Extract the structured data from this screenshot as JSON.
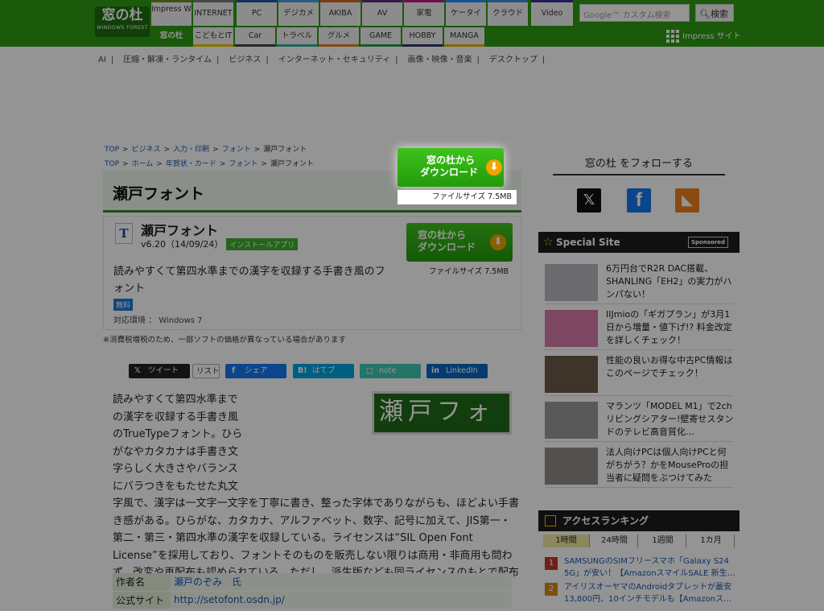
{
  "header": {
    "logo": {
      "main": "窓の杜",
      "sub": "WINDOWS FOREST"
    },
    "nav_row1": [
      {
        "label": "Impress Watch",
        "color": "#6b8e23"
      },
      {
        "label": "INTERNET",
        "color": "#7a7a7a"
      },
      {
        "label": "PC",
        "color": "#2156a5"
      },
      {
        "label": "デジカメ",
        "color": "#4aa0d8"
      },
      {
        "label": "AKIBA",
        "color": "#d2691e"
      },
      {
        "label": "AV",
        "color": "#5b2c83"
      },
      {
        "label": "家電",
        "color": "#c71585"
      },
      {
        "label": "ケータイ",
        "color": "#1e90ff"
      },
      {
        "label": "クラウド",
        "color": "#3a8fd8"
      },
      {
        "label": "Video",
        "color": "#333399"
      }
    ],
    "nav_row2": [
      {
        "label": "窓の杜",
        "color": "#2f9a14"
      },
      {
        "label": "こどもとIT",
        "color": "#f0c000"
      },
      {
        "label": "Car",
        "color": "#444444"
      },
      {
        "label": "トラベル",
        "color": "#2ab0a0"
      },
      {
        "label": "グルメ",
        "color": "#e08020"
      },
      {
        "label": "GAME",
        "color": "#2a9a4a"
      },
      {
        "label": "HOBBY",
        "color": "#333366"
      },
      {
        "label": "MANGA",
        "color": "#e4b000"
      }
    ],
    "search_placeholder": "Google™ カスタム検索",
    "search_button": "検索",
    "impress_link": "Impress サイト"
  },
  "subnav": [
    "AI",
    "|",
    "圧縮・解凍・ランタイム",
    "|",
    "ビジネス",
    "|",
    "インターネット・セキュリティ",
    "|",
    "画像・映像・音楽",
    "|",
    "デスクトップ",
    "|"
  ],
  "breadcrumbs": {
    "line1": [
      "TOP",
      ">",
      "ビジネス",
      ">",
      "入力・印刷",
      ">",
      "フォント",
      ">",
      "瀬戸フォント"
    ],
    "line2": [
      "TOP",
      ">",
      "ホーム",
      ">",
      "年賀状・カード",
      ">",
      "フォント",
      ">",
      "瀬戸フォント"
    ]
  },
  "page_title": "瀬戸フォント",
  "software": {
    "icon_letter": "T",
    "name": "瀬戸フォント",
    "version": "v6.20（14/09/24）",
    "type_badge": "インストールアプリ",
    "download_button_line1": "窓の杜から",
    "download_button_line2": "ダウンロード",
    "file_size": "ファイルサイズ 7.5MB",
    "description": "読みやすくて第四水準までの漢字を収録する手書き風のフォント",
    "price_badge": "無料",
    "environment": "対応環境 ： Windows 7"
  },
  "notice": "※消費税増税のため、一部ソフトの価格が異なっている場合があります",
  "share": {
    "tweet": "ツイート",
    "list": "リスト",
    "facebook": "シェア",
    "hatena": "はてブ",
    "note": "note",
    "linkedin": "LinkedIn"
  },
  "article_image_text": "瀬戸フォ",
  "article": "読みやすくて第四水準までの漢字を収録する手書き風のTrueTypeフォント。ひらがなやカタカナは手書き文字らしく大きさやバランスにバラつきをもたせた丸文字風で、漢字は一文字一文字を丁寧に書き、整った字体でありながらも、ほどよい手書き感がある。ひらがな、カタカナ、アルファベット、数字、記号に加えて、JIS第一・第二・第三・第四水準の漢字を収録している。ライセンスは“SIL Open Font License”を採用しており、フォントそのものを販売しない限りは商用・非商用も問わず、改変や再配布も認められている。ただし、派生版なども同ライセンスのもとで配布しなければならない。",
  "info_table": [
    {
      "key": "作者名",
      "value": "瀬戸のぞみ　氏"
    },
    {
      "key": "公式サイト",
      "value": "http://setofont.osdn.jp/"
    }
  ],
  "follow": {
    "title": "窓の杜 をフォローする",
    "x": "𝕏",
    "facebook": "f",
    "rss": "◣"
  },
  "special": {
    "title": "Special Site",
    "sponsored": "Sponsored",
    "items": [
      {
        "text": "6万円台でR2R DAC搭載、SHANLING「EH2」の実力がハンパない！",
        "thumb": "#b7b7bf"
      },
      {
        "text": "IIJmioの「ギガプラン」が3月1日から増量・値下げ!? 料金改定を詳しくチェック！",
        "thumb": "#d87aa8"
      },
      {
        "text": "性能の良いお得な中古PC情報はこのページでチェック！",
        "thumb": "#6d5a48"
      },
      {
        "text": "マランツ「MODEL M1」で2chリビングシアター!壁寄せスタンドのテレビ高音質化…",
        "thumb": "#9a9a9a"
      },
      {
        "text": "法人向けPCは個人向けPCと何がちがう？かをMouseProの担当者に疑問をぶつけてみた",
        "thumb": "#8f8a86"
      }
    ]
  },
  "ranking": {
    "title": "アクセスランキング",
    "tabs": [
      "1時間",
      "24時間",
      "1週間",
      "1カ月"
    ],
    "items": [
      {
        "rank": "1",
        "text": "SAMSUNGのSIMフリースマホ「Galaxy S24 5G」が安い！【AmazonスマイルSALE 新生…",
        "color": "#c0392b"
      },
      {
        "rank": "2",
        "text": "アイリスオーヤマのAndroidタブレットが最安13,800円、10インチモデルも【Amazonス…",
        "color": "#d48a1a"
      }
    ]
  }
}
